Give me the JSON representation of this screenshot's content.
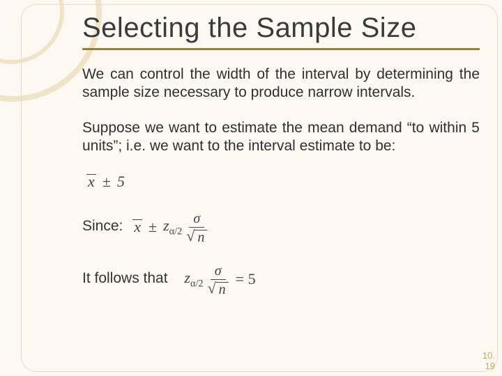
{
  "title": "Selecting the Sample Size",
  "para1": "We can control the width of the interval by determining the sample size necessary to produce narrow intervals.",
  "para2": "Suppose we want to estimate the mean demand “to within 5 units”; i.e. we want to the interval estimate to be:",
  "since_label": "Since:",
  "follows_label": "It follows that",
  "eq": {
    "x": "x",
    "pm": "±",
    "five": "5",
    "z": "z",
    "alpha_half": "α/2",
    "sigma": "σ",
    "sqrt": "√",
    "n": "n",
    "equals5": "= 5"
  },
  "page": {
    "chapter": "10.",
    "num": "19"
  }
}
